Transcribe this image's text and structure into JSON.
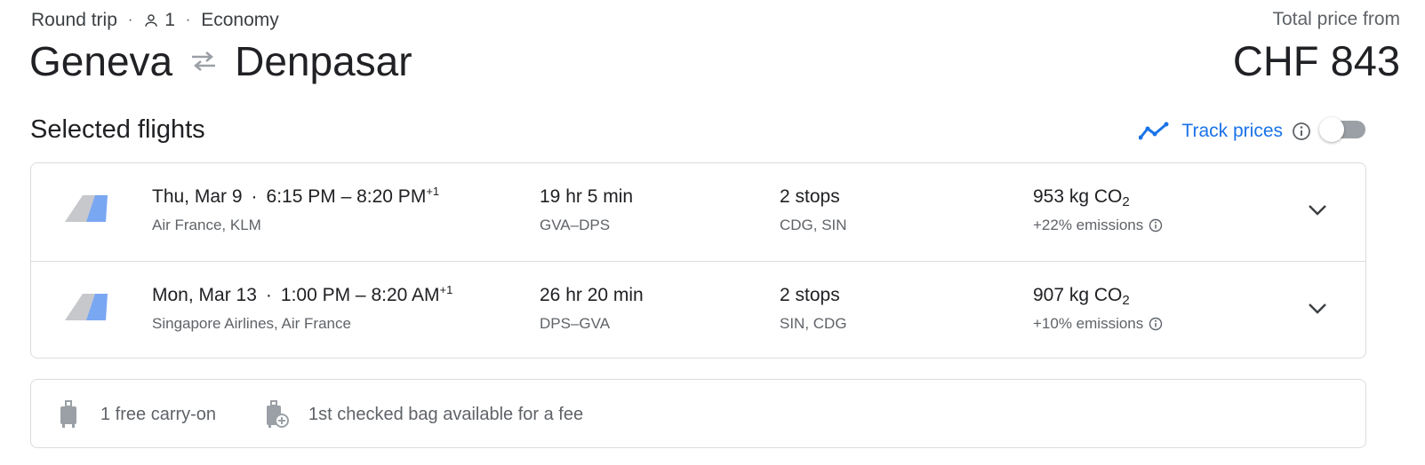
{
  "trip": {
    "type": "Round trip",
    "passengers": "1",
    "cabin": "Economy",
    "origin": "Geneva",
    "destination": "Denpasar",
    "price_label": "Total price from",
    "price": "CHF 843"
  },
  "section": {
    "title": "Selected flights",
    "track_label": "Track prices",
    "track_enabled": false
  },
  "flights": [
    {
      "date": "Thu, Mar 9",
      "times": "6:15 PM – 8:20 PM",
      "day_offset": "+1",
      "airlines": "Air France, KLM",
      "duration": "19 hr 5 min",
      "route": "GVA–DPS",
      "stops": "2 stops",
      "stop_codes": "CDG, SIN",
      "co2": "953 kg CO",
      "co2_sub": "2",
      "emissions": "+22% emissions"
    },
    {
      "date": "Mon, Mar 13",
      "times": "1:00 PM – 8:20 AM",
      "day_offset": "+1",
      "airlines": "Singapore Airlines, Air France",
      "duration": "26 hr 20 min",
      "route": "DPS–GVA",
      "stops": "2 stops",
      "stop_codes": "SIN, CDG",
      "co2": "907 kg CO",
      "co2_sub": "2",
      "emissions": "+10% emissions"
    }
  ],
  "bags": {
    "carry_on": "1 free carry-on",
    "checked": "1st checked bag available for a fee"
  },
  "colors": {
    "accent": "#1a73e8",
    "text": "#202124",
    "secondary": "#5f6368",
    "border": "#dadce0",
    "logo_gray": "#c6c8cc",
    "logo_blue": "#7aa7f2"
  },
  "icons": {
    "passenger": "person-icon",
    "swap": "swap-arrows-icon",
    "track": "trend-line-icon",
    "info": "info-icon",
    "expand": "chevron-down-icon",
    "carry_on": "carry-on-bag-icon",
    "checked": "checked-bag-icon"
  }
}
